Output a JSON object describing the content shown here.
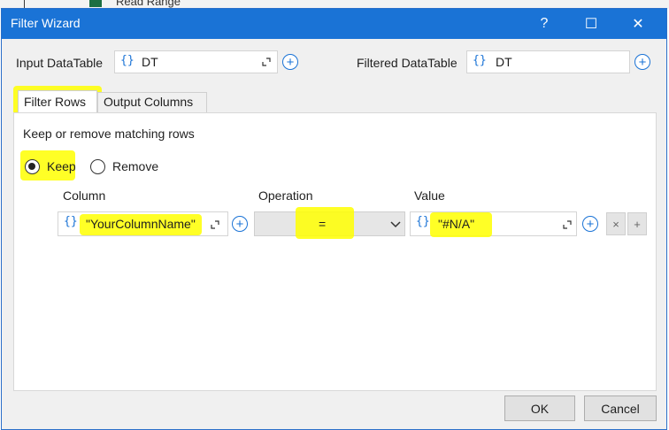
{
  "background": {
    "label": "Read Range"
  },
  "window": {
    "title": "Filter Wizard",
    "help": "?",
    "maximize": "☐",
    "close": "✕"
  },
  "input": {
    "label": "Input DataTable",
    "value": "DT",
    "brace": "{}"
  },
  "output": {
    "label": "Filtered DataTable",
    "value": "DT",
    "brace": "{}"
  },
  "tabs": [
    {
      "label": "Filter Rows"
    },
    {
      "label": "Output Columns"
    }
  ],
  "filter": {
    "description": "Keep or remove matching rows",
    "keep_label": "Keep",
    "remove_label": "Remove",
    "selected": "Keep",
    "headers": {
      "column": "Column",
      "operation": "Operation",
      "value": "Value"
    },
    "row": {
      "column": "\"YourColumnName\"",
      "operation": "=",
      "value": "\"#N/A\"",
      "remove_btn": "×",
      "add_btn": "+"
    }
  },
  "footer": {
    "ok": "OK",
    "cancel": "Cancel"
  },
  "colors": {
    "accent": "#1a73d6",
    "highlight": "#ffff00"
  }
}
